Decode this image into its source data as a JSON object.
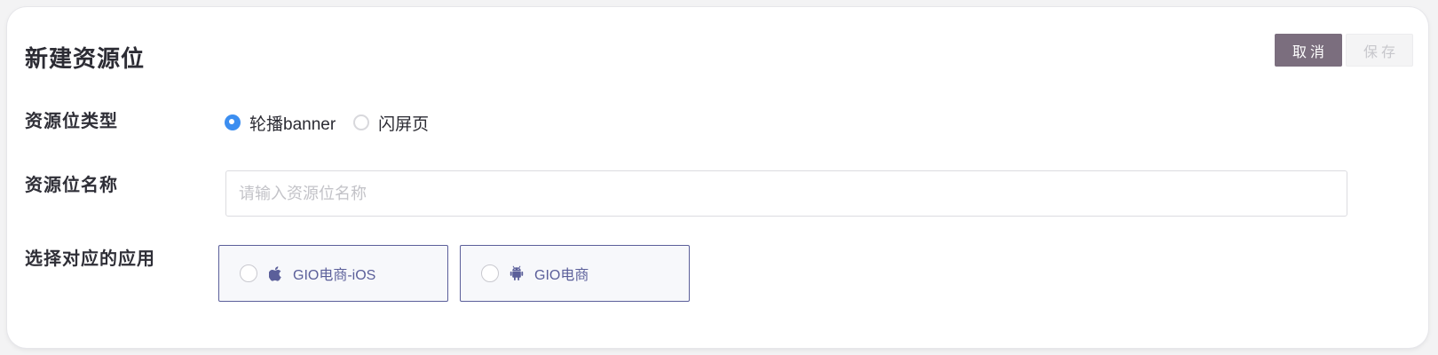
{
  "header": {
    "title": "新建资源位",
    "cancel_label": "取消",
    "save_label": "保存"
  },
  "form": {
    "type_row": {
      "label": "资源位类型",
      "options": [
        {
          "label": "轮播banner",
          "checked": true
        },
        {
          "label": "闪屏页",
          "checked": false
        }
      ]
    },
    "name_row": {
      "label": "资源位名称",
      "value": "",
      "placeholder": "请输入资源位名称"
    },
    "app_row": {
      "label": "选择对应的应用",
      "apps": [
        {
          "name": "GIO电商-iOS",
          "icon": "apple-icon",
          "checked": false
        },
        {
          "name": "GIO电商",
          "icon": "android-icon",
          "checked": false
        }
      ]
    }
  },
  "colors": {
    "cancel_button_bg": "#7b6e7e",
    "radio_checked": "#3c8ef0",
    "app_accent": "#5b5f9a"
  }
}
